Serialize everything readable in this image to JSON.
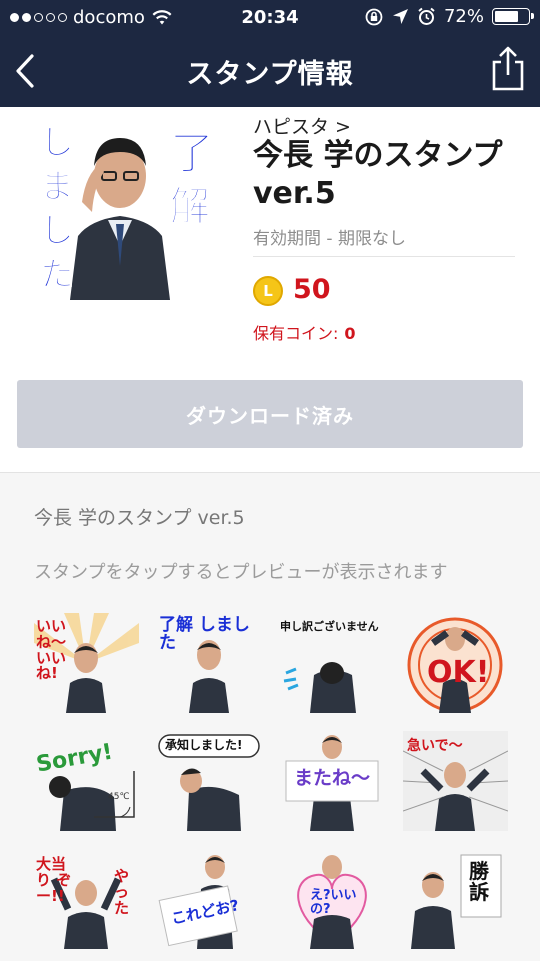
{
  "status_bar": {
    "carrier": "docomo",
    "time": "20:34",
    "battery": "72%",
    "battery_level": 0.72
  },
  "nav": {
    "title": "スタンプ情報"
  },
  "product": {
    "creator_link": "ハピスタ >",
    "title": "今長 学のスタンプ ver.5",
    "validity": "有効期間 - 期限なし",
    "coin_icon_letter": "L",
    "price": "50",
    "owned_coins_label": "保有コイン:",
    "owned_coins_value": "0",
    "thumbnail_text": {
      "left": "しました",
      "right_top": "了",
      "right": "解"
    }
  },
  "download_button": {
    "label": "ダウンロード済み"
  },
  "preview": {
    "title": "今長 学のスタンプ ver.5",
    "hint": "スタンプをタップするとプレビューが表示されます",
    "stickers": [
      {
        "text": "いいね〜 いいね!"
      },
      {
        "text": "了解 しました"
      },
      {
        "text": "申し訳ございません"
      },
      {
        "text": "OK!"
      },
      {
        "text": "Sorry!",
        "text2": "45℃"
      },
      {
        "text": "承知しました!"
      },
      {
        "text": "またね〜"
      },
      {
        "text": "急いで〜"
      },
      {
        "text": "大当り ぞー!!",
        "text2": "やった"
      },
      {
        "text": "これどお?"
      },
      {
        "text": "え?いいの?"
      },
      {
        "text": "勝訴"
      }
    ]
  },
  "colors": {
    "header_bg": "#1d2841",
    "price_red": "#d0151d",
    "coin_yellow": "#f5c518",
    "disabled_button": "#cdd0d9",
    "sticker_blue": "#1a2fd6"
  }
}
